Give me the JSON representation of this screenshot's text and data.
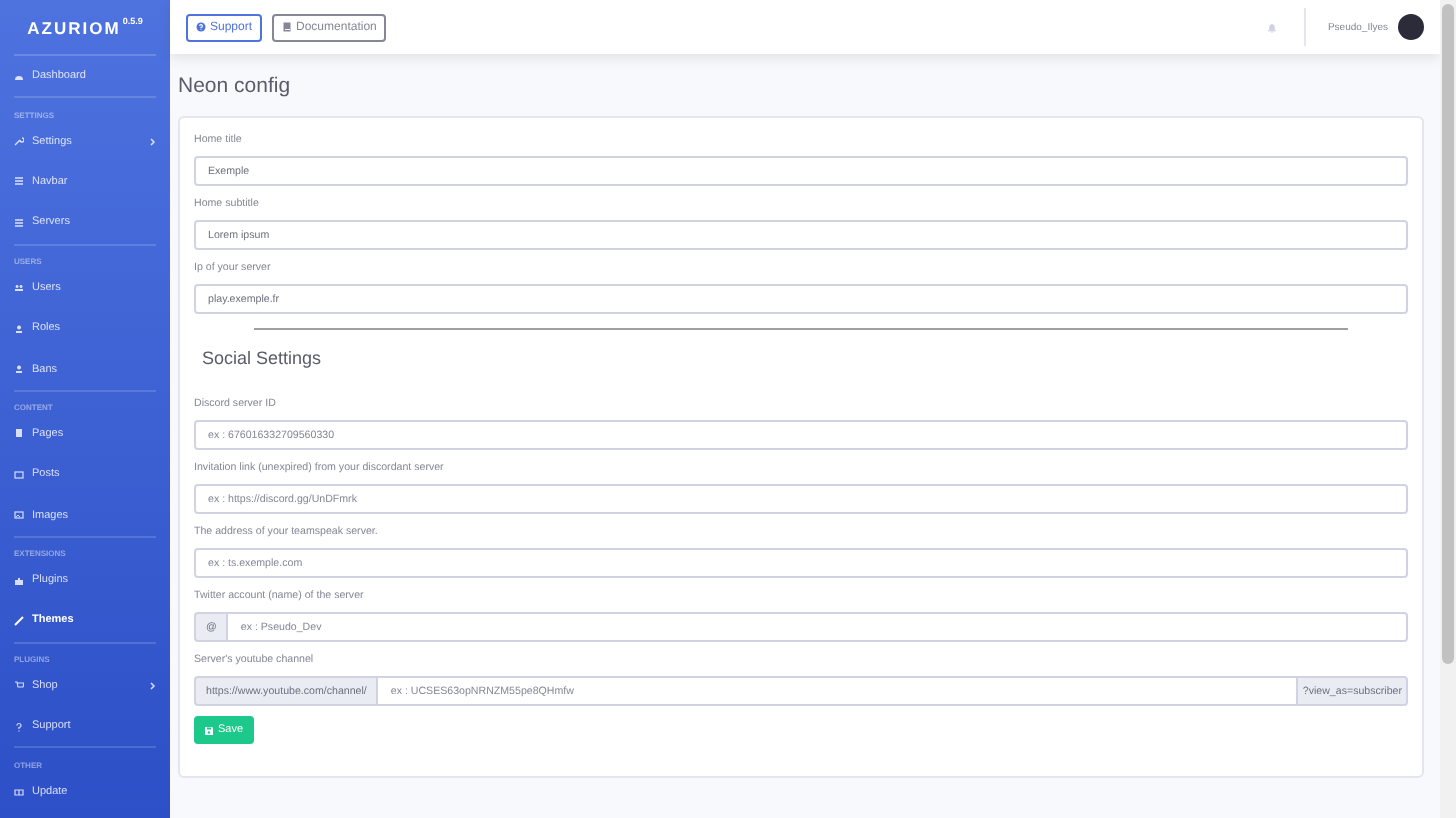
{
  "sidebar": {
    "logo": "AZURIOM",
    "version": "0.5.9",
    "sections": [
      {
        "items": [
          {
            "label": "Dashboard",
            "selected": false,
            "has_submenu": false
          }
        ]
      },
      {
        "title": "SETTINGS",
        "items": [
          {
            "label": "Settings",
            "selected": false,
            "has_submenu": true
          },
          {
            "label": "Navbar",
            "selected": false,
            "has_submenu": false
          },
          {
            "label": "Servers",
            "selected": false,
            "has_submenu": false
          }
        ]
      },
      {
        "title": "USERS",
        "items": [
          {
            "label": "Users",
            "selected": false,
            "has_submenu": false
          },
          {
            "label": "Roles",
            "selected": false,
            "has_submenu": false
          },
          {
            "label": "Bans",
            "selected": false,
            "has_submenu": false
          }
        ]
      },
      {
        "title": "CONTENT",
        "items": [
          {
            "label": "Pages",
            "selected": false,
            "has_submenu": false
          },
          {
            "label": "Posts",
            "selected": false,
            "has_submenu": false
          },
          {
            "label": "Images",
            "selected": false,
            "has_submenu": false
          }
        ]
      },
      {
        "title": "EXTENSIONS",
        "items": [
          {
            "label": "Plugins",
            "selected": false,
            "has_submenu": false
          },
          {
            "label": "Themes",
            "selected": true,
            "has_submenu": false
          }
        ]
      },
      {
        "title": "PLUGINS",
        "items": [
          {
            "label": "Shop",
            "selected": false,
            "has_submenu": true
          },
          {
            "label": "Support",
            "selected": false,
            "has_submenu": false
          }
        ]
      },
      {
        "title": "OTHER",
        "items": [
          {
            "label": "Update",
            "selected": false,
            "has_submenu": false
          }
        ]
      }
    ]
  },
  "topbar": {
    "buttons": [
      "Support",
      "Documentation"
    ],
    "user": "Pseudo_Ilyes"
  },
  "page_title": "Neon config",
  "general_fields": [
    {
      "label": "Home title",
      "value": "Exemple"
    },
    {
      "label": "Home subtitle",
      "value": "Lorem ipsum"
    },
    {
      "label": "Ip of your server",
      "value": "play.exemple.fr"
    }
  ],
  "social_heading": "Social Settings",
  "social_fields": [
    {
      "label": "Discord server ID",
      "placeholder": "ex : 676016332709560330"
    },
    {
      "label": "Invitation link (unexpired) from your discordant server",
      "placeholder": "ex : https://discord.gg/UnDFmrk"
    },
    {
      "label": "The address of your teamspeak server.",
      "placeholder": "ex : ts.exemple.com"
    },
    {
      "label": "Twitter account (name) of the server",
      "prepend": "@",
      "placeholder": "ex : Pseudo_Dev"
    },
    {
      "label": "Server's youtube channel",
      "prepend": "https://www.youtube.com/channel/",
      "placeholder": "ex : UCSES63opNRNZM55pe8QHmfw",
      "append": "?view_as=subscriber"
    }
  ],
  "save_button": "Save"
}
